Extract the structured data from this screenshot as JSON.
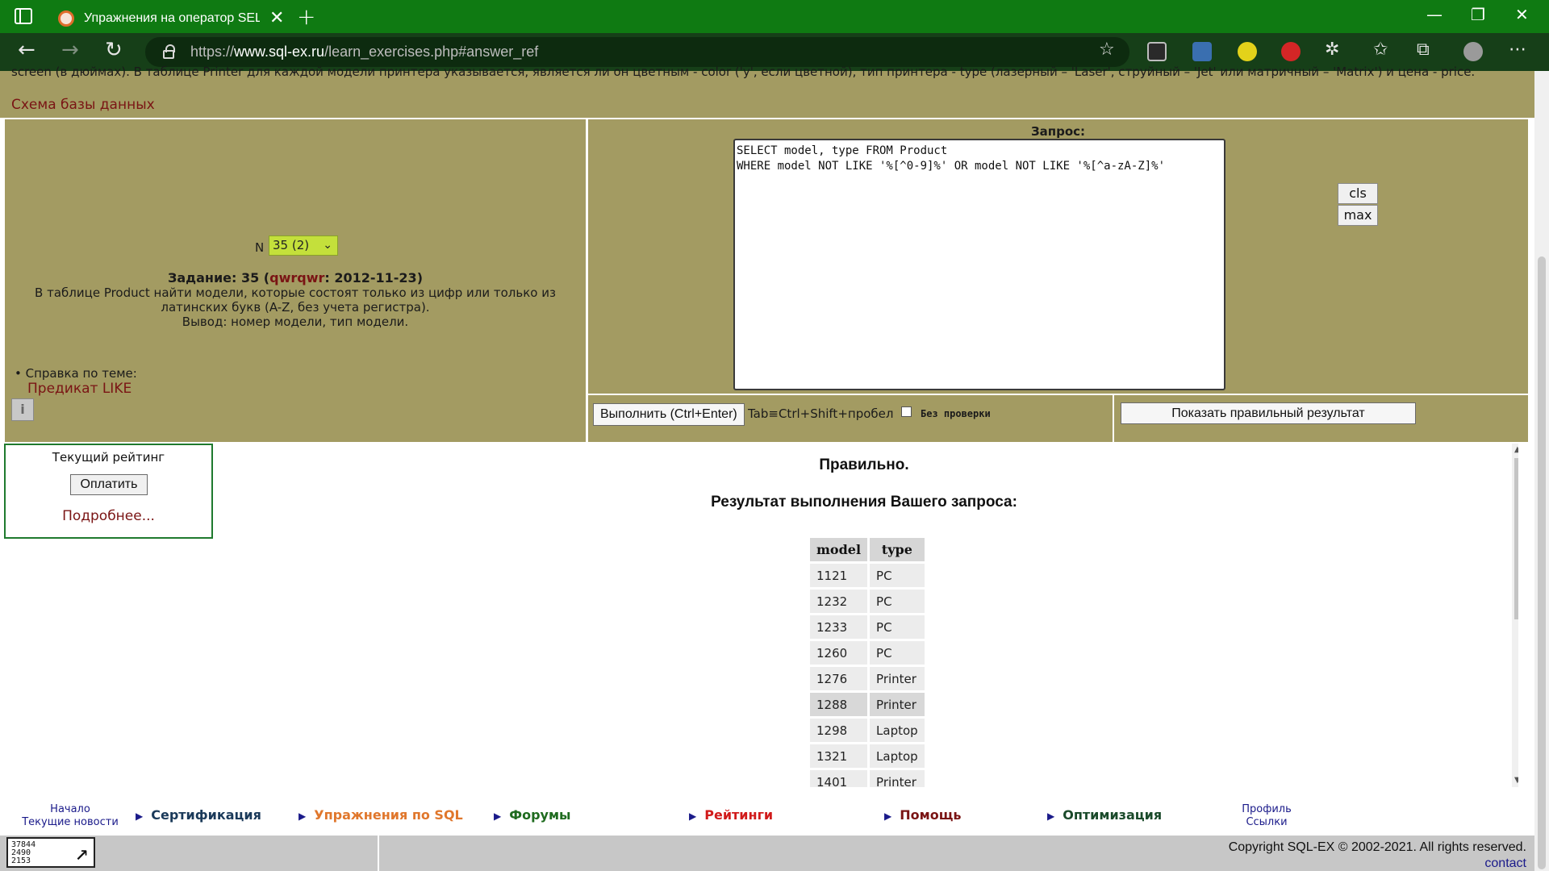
{
  "browser": {
    "tab_title": "Упражнения на оператор SELECT",
    "url_prefix": "https://",
    "url_domain": "www.sql-ex.ru",
    "url_path": "/learn_exercises.php#answer_ref",
    "window_controls": [
      "—",
      "❐",
      "✕"
    ]
  },
  "intro": {
    "text": "screen (в дюймах). В таблице Printer для каждой модели принтера указывается, является ли он цветным - color ('y', если цветной), тип принтера - type (лазерный – 'Laser', струйный – 'Jet' или матричный – 'Matrix') и цена - price.",
    "schema_link": "Схема базы данных"
  },
  "exercise": {
    "n_label": "N",
    "selected": "35 (2)",
    "task_prefix": "Задание: 35 (",
    "author": "qwrqwr",
    "task_date": ": 2012-11-23)",
    "task_line1": "В таблице Product найти модели, которые состоят только из цифр или только из",
    "task_line2": "латинских букв (A-Z, без учета регистра).",
    "task_line3": "Вывод: номер модели, тип модели.",
    "help_label": "• Справка по теме:",
    "help_link": "Предикат LIKE"
  },
  "query": {
    "label": "Запрос:",
    "text": "SELECT model, type FROM Product\nWHERE model NOT LIKE '%[^0-9]%' OR model NOT LIKE '%[^a-zA-Z]%'",
    "cls_label": "cls",
    "max_label": "max",
    "execute_label": "Выполнить (Ctrl+Enter)",
    "tab_hint": "Tab≡Ctrl+Shift+пробел",
    "noverify_label": "Без проверки",
    "show_correct_label": "Показать правильный результат"
  },
  "rating": {
    "title": "Текущий рейтинг",
    "pay_label": "Оплатить",
    "more_link": "Подробнее..."
  },
  "result": {
    "status": "Правильно.",
    "title": "Результат выполнения Вашего запроса:",
    "columns": [
      "model",
      "type"
    ],
    "rows": [
      [
        "1121",
        "PC"
      ],
      [
        "1232",
        "PC"
      ],
      [
        "1233",
        "PC"
      ],
      [
        "1260",
        "PC"
      ],
      [
        "1276",
        "Printer"
      ],
      [
        "1288",
        "Printer"
      ],
      [
        "1298",
        "Laptop"
      ],
      [
        "1321",
        "Laptop"
      ],
      [
        "1401",
        "Printer"
      ]
    ]
  },
  "footer": {
    "home": "Начало",
    "news": "Текущие новости",
    "items": [
      {
        "label": "Сертификация",
        "color": "#1b3a5a"
      },
      {
        "label": "Упражнения по SQL",
        "color": "#e0772c"
      },
      {
        "label": "Форумы",
        "color": "#1f6b1f"
      },
      {
        "label": "Рейтинги",
        "color": "#d11b1b"
      },
      {
        "label": "Помощь",
        "color": "#7a1414"
      },
      {
        "label": "Оптимизация",
        "color": "#1a4a2a"
      }
    ],
    "profile": "Профиль",
    "links": "Ссылки",
    "counter_lines": [
      "37844",
      "2490",
      "2153"
    ],
    "copyright": "Copyright SQL-EX © 2002-2021. All rights reserved.",
    "contact": "contact"
  }
}
